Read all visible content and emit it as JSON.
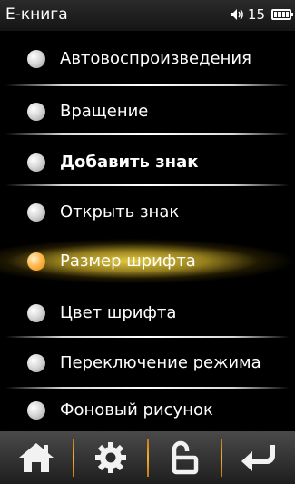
{
  "status": {
    "title": "Е-книга",
    "volume": "15",
    "volume_icon": "speaker-icon",
    "battery_icon": "battery-icon"
  },
  "menu": {
    "items": [
      {
        "label": "Автовоспроизведения",
        "selected": false
      },
      {
        "label": "Вращение",
        "selected": false
      },
      {
        "label": "Добавить знак",
        "selected": false
      },
      {
        "label": "Открыть знак",
        "selected": false
      },
      {
        "label": "Размер шрифта",
        "selected": true
      },
      {
        "label": "Цвет шрифта",
        "selected": false
      },
      {
        "label": "Переключение режима",
        "selected": false
      },
      {
        "label": "Фоновый рисунок",
        "selected": false
      }
    ]
  },
  "toolbar": {
    "buttons": [
      "home-icon",
      "gear-icon",
      "lock-icon",
      "back-arrow-icon"
    ],
    "accent": "#f0b03a"
  }
}
